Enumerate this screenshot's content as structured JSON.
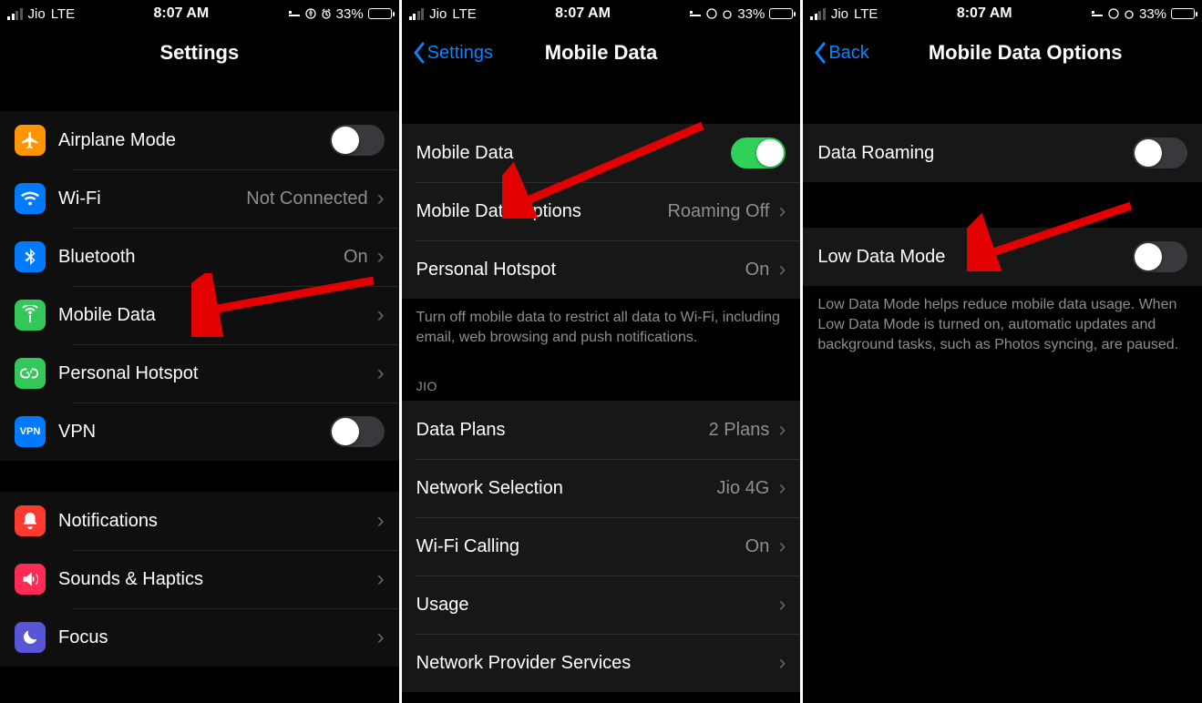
{
  "status": {
    "carrier": "Jio",
    "network": "LTE",
    "time": "8:07 AM",
    "battery": "33%"
  },
  "screen1": {
    "title": "Settings",
    "rows": {
      "airplane": "Airplane Mode",
      "wifi": "Wi-Fi",
      "wifi_value": "Not Connected",
      "bluetooth": "Bluetooth",
      "bluetooth_value": "On",
      "mobile": "Mobile Data",
      "hotspot": "Personal Hotspot",
      "vpn": "VPN",
      "notifications": "Notifications",
      "sounds": "Sounds & Haptics",
      "focus": "Focus"
    }
  },
  "screen2": {
    "back": "Settings",
    "title": "Mobile Data",
    "rows": {
      "mobile_data": "Mobile Data",
      "options": "Mobile Data Options",
      "options_value": "Roaming Off",
      "hotspot": "Personal Hotspot",
      "hotspot_value": "On"
    },
    "footer1": "Turn off mobile data to restrict all data to Wi-Fi, including email, web browsing and push notifications.",
    "section_jio": "JIO",
    "rows2": {
      "plans": "Data Plans",
      "plans_value": "2 Plans",
      "network": "Network Selection",
      "network_value": "Jio 4G",
      "wifi_call": "Wi-Fi Calling",
      "wifi_call_value": "On",
      "usage": "Usage",
      "provider": "Network Provider Services"
    }
  },
  "screen3": {
    "back": "Back",
    "title": "Mobile Data Options",
    "rows": {
      "roaming": "Data Roaming",
      "low_data": "Low Data Mode"
    },
    "footer": "Low Data Mode helps reduce mobile data usage. When Low Data Mode is turned on, automatic updates and background tasks, such as Photos syncing, are paused."
  }
}
